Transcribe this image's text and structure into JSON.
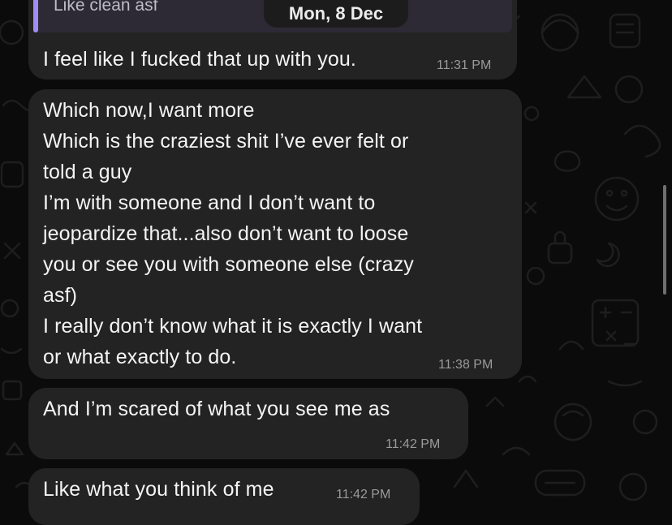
{
  "date_separator": "Mon, 8 Dec",
  "messages": [
    {
      "quote": "Like clean asf",
      "text": "I feel like I fucked that up with you.",
      "time": "11:31 PM"
    },
    {
      "text": "Which now,I want more\nWhich is the craziest shit I’ve ever felt or\ntold a guy\nI’m with someone and I don’t want to\njeopardize that...also don’t want to loose\nyou or see you with someone else (crazy\nasf)\nI really don’t know what it is exactly I want\nor what exactly to do.",
      "time": "11:38 PM"
    },
    {
      "text": "And I’m scared of what you see me as",
      "time": "11:42 PM"
    },
    {
      "text": "Like what you think of me",
      "time": "11:42 PM"
    }
  ],
  "colors": {
    "background": "#0b0b0b",
    "bubble": "#232323",
    "quote_accent": "#a18cf5",
    "timestamp": "#9a9a9a"
  }
}
